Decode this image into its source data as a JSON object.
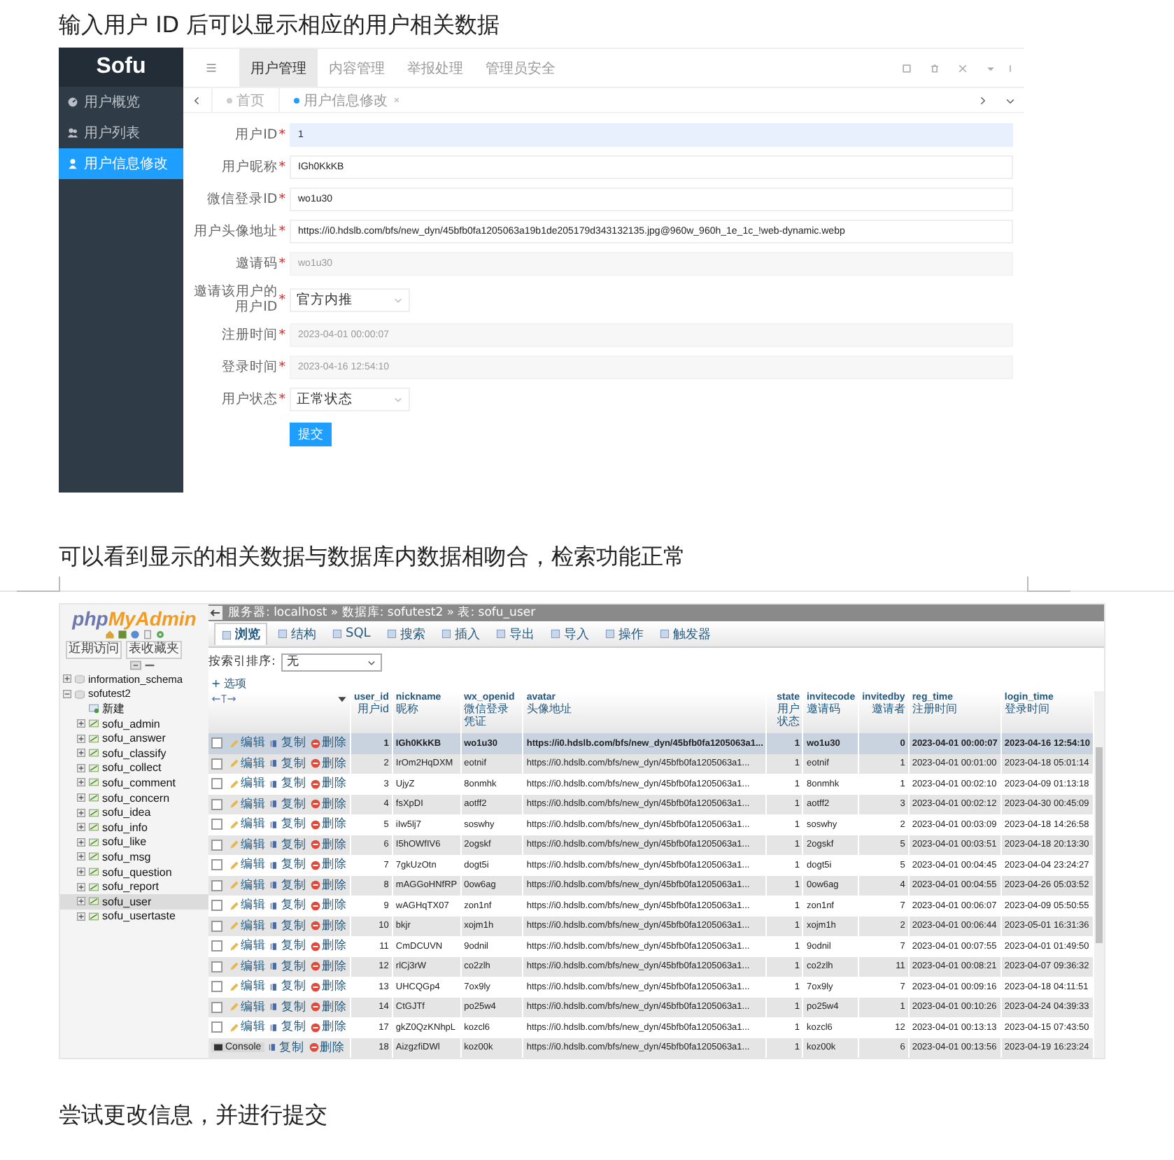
{
  "intro_text": "输入用户 ID 后可以显示相应的用户相关数据",
  "admin": {
    "logo": "Sofu",
    "sidebar": [
      {
        "label": "用户概览",
        "selected": false
      },
      {
        "label": "用户列表",
        "selected": false
      },
      {
        "label": "用户信息修改",
        "selected": true
      }
    ],
    "top_tabs": [
      {
        "label": "用户管理",
        "selected": true
      },
      {
        "label": "内容管理",
        "selected": false
      },
      {
        "label": "举报处理",
        "selected": false
      },
      {
        "label": "管理员安全",
        "selected": false
      }
    ],
    "page_tabs": [
      {
        "label": "首页",
        "selected": false,
        "closable": false
      },
      {
        "label": "用户信息修改",
        "selected": true,
        "closable": true
      }
    ],
    "fields": [
      {
        "label": "用户ID",
        "mark": "*",
        "kind": "autofill",
        "value": "1"
      },
      {
        "label": "用户昵称",
        "mark": "*",
        "kind": "input",
        "value": "IGh0KkKB"
      },
      {
        "label": "微信登录ID",
        "mark": "*",
        "kind": "input",
        "value": "wo1u30"
      },
      {
        "label": "用户头像地址",
        "mark": "*",
        "kind": "input",
        "value": "https://i0.hdslb.com/bfs/new_dyn/45bfb0fa1205063a19b1de205179d343132135.jpg@960w_960h_1e_1c_!web-dynamic.webp"
      },
      {
        "label": "邀请码",
        "mark": "*",
        "kind": "readonly",
        "value": "wo1u30"
      },
      {
        "label": "邀请该用户的用户ID",
        "mark": "*",
        "kind": "select",
        "value": "官方内推"
      },
      {
        "label": "注册时间",
        "mark": "*",
        "kind": "readonly",
        "value": "2023-04-01 00:00:07"
      },
      {
        "label": "登录时间",
        "mark": "*",
        "kind": "readonly",
        "value": "2023-04-16 12:54:10"
      },
      {
        "label": "用户状态",
        "mark": "*",
        "kind": "select",
        "value": "正常状态"
      }
    ],
    "submit": "提交"
  },
  "result_text": "可以看到显示的相关数据与数据库内数据相吻合，检索功能正常",
  "pma": {
    "logo": {
      "prefix": "php",
      "name": "MyAdmin"
    },
    "nav_buttons": [
      "近期访问",
      "表收藏夹"
    ],
    "tree": [
      {
        "label": "information_schema",
        "kind": "db",
        "expanded": false,
        "selected": false
      },
      {
        "label": "sofutest2",
        "kind": "db",
        "expanded": true,
        "selected": false,
        "children": [
          {
            "label": "新建",
            "kind": "new",
            "selected": false
          },
          {
            "label": "sofu_admin",
            "kind": "table",
            "selected": false
          },
          {
            "label": "sofu_answer",
            "kind": "table",
            "selected": false
          },
          {
            "label": "sofu_classify",
            "kind": "table",
            "selected": false
          },
          {
            "label": "sofu_collect",
            "kind": "table",
            "selected": false
          },
          {
            "label": "sofu_comment",
            "kind": "table",
            "selected": false
          },
          {
            "label": "sofu_concern",
            "kind": "table",
            "selected": false
          },
          {
            "label": "sofu_idea",
            "kind": "table",
            "selected": false
          },
          {
            "label": "sofu_info",
            "kind": "table",
            "selected": false
          },
          {
            "label": "sofu_like",
            "kind": "table",
            "selected": false
          },
          {
            "label": "sofu_msg",
            "kind": "table",
            "selected": false
          },
          {
            "label": "sofu_question",
            "kind": "table",
            "selected": false
          },
          {
            "label": "sofu_report",
            "kind": "table",
            "selected": false
          },
          {
            "label": "sofu_user",
            "kind": "table",
            "selected": true
          },
          {
            "label": "sofu_usertaste",
            "kind": "table",
            "selected": false
          }
        ]
      }
    ],
    "breadcrumb": "服务器: localhost » 数据库: sofutest2 » 表: sofu_user",
    "tabs": [
      {
        "label": "浏览",
        "selected": true
      },
      {
        "label": "结构",
        "selected": false
      },
      {
        "label": "SQL",
        "selected": false
      },
      {
        "label": "搜索",
        "selected": false
      },
      {
        "label": "插入",
        "selected": false
      },
      {
        "label": "导出",
        "selected": false
      },
      {
        "label": "导入",
        "selected": false
      },
      {
        "label": "操作",
        "selected": false
      },
      {
        "label": "触发器",
        "selected": false
      }
    ],
    "sort_label": "按索引排序:",
    "sort_value": "无",
    "options_link": "+ 选项",
    "console_label": "Console",
    "columns": [
      {
        "name": "user_id",
        "comment": "用户id",
        "numeric": true
      },
      {
        "name": "nickname",
        "comment": "昵称",
        "numeric": false
      },
      {
        "name": "wx_openid",
        "comment": "微信登录凭证",
        "numeric": false
      },
      {
        "name": "avatar",
        "comment": "头像地址",
        "numeric": false
      },
      {
        "name": "state",
        "comment": "用户状态",
        "numeric": true
      },
      {
        "name": "invitecode",
        "comment": "邀请码",
        "numeric": false
      },
      {
        "name": "invitedby",
        "comment": "邀请者",
        "numeric": true
      },
      {
        "name": "reg_time",
        "comment": "注册时间",
        "numeric": false
      },
      {
        "name": "login_time",
        "comment": "登录时间",
        "numeric": false
      }
    ],
    "rows": [
      {
        "kind": "normal",
        "selected": true,
        "actions": [
          {
            "kind": "edit",
            "label": "编辑"
          },
          {
            "kind": "copy",
            "label": "复制"
          },
          {
            "kind": "delete",
            "label": "删除"
          }
        ],
        "cells": [
          "1",
          "IGh0KkKB",
          "wo1u30",
          "https://i0.hdslb.com/bfs/new_dyn/45bfb0fa1205063a1...",
          "1",
          "wo1u30",
          "0",
          "2023-04-01 00:00:07",
          "2023-04-16 12:54:10"
        ]
      },
      {
        "kind": "normal",
        "selected": false,
        "actions": [
          {
            "kind": "edit",
            "label": "编辑"
          },
          {
            "kind": "copy",
            "label": "复制"
          },
          {
            "kind": "delete",
            "label": "删除"
          }
        ],
        "cells": [
          "2",
          "IrOm2HqDXM",
          "eotnif",
          "https://i0.hdslb.com/bfs/new_dyn/45bfb0fa1205063a1...",
          "1",
          "eotnif",
          "1",
          "2023-04-01 00:01:00",
          "2023-04-18 05:01:14"
        ]
      },
      {
        "kind": "normal",
        "selected": false,
        "actions": [
          {
            "kind": "edit",
            "label": "编辑"
          },
          {
            "kind": "copy",
            "label": "复制"
          },
          {
            "kind": "delete",
            "label": "删除"
          }
        ],
        "cells": [
          "3",
          "UjyZ",
          "8onmhk",
          "https://i0.hdslb.com/bfs/new_dyn/45bfb0fa1205063a1...",
          "1",
          "8onmhk",
          "1",
          "2023-04-01 00:02:10",
          "2023-04-09 01:13:18"
        ]
      },
      {
        "kind": "normal",
        "selected": false,
        "actions": [
          {
            "kind": "edit",
            "label": "编辑"
          },
          {
            "kind": "copy",
            "label": "复制"
          },
          {
            "kind": "delete",
            "label": "删除"
          }
        ],
        "cells": [
          "4",
          "fsXpDI",
          "aotff2",
          "https://i0.hdslb.com/bfs/new_dyn/45bfb0fa1205063a1...",
          "1",
          "aotff2",
          "3",
          "2023-04-01 00:02:12",
          "2023-04-30 00:45:09"
        ]
      },
      {
        "kind": "normal",
        "selected": false,
        "actions": [
          {
            "kind": "edit",
            "label": "编辑"
          },
          {
            "kind": "copy",
            "label": "复制"
          },
          {
            "kind": "delete",
            "label": "删除"
          }
        ],
        "cells": [
          "5",
          "iIw5lj7",
          "soswhy",
          "https://i0.hdslb.com/bfs/new_dyn/45bfb0fa1205063a1...",
          "1",
          "soswhy",
          "2",
          "2023-04-01 00:03:09",
          "2023-04-18 14:26:58"
        ]
      },
      {
        "kind": "normal",
        "selected": false,
        "actions": [
          {
            "kind": "edit",
            "label": "编辑"
          },
          {
            "kind": "copy",
            "label": "复制"
          },
          {
            "kind": "delete",
            "label": "删除"
          }
        ],
        "cells": [
          "6",
          "I5hOWfIV6",
          "2ogskf",
          "https://i0.hdslb.com/bfs/new_dyn/45bfb0fa1205063a1...",
          "1",
          "2ogskf",
          "5",
          "2023-04-01 00:03:51",
          "2023-04-18 20:13:30"
        ]
      },
      {
        "kind": "normal",
        "selected": false,
        "actions": [
          {
            "kind": "edit",
            "label": "编辑"
          },
          {
            "kind": "copy",
            "label": "复制"
          },
          {
            "kind": "delete",
            "label": "删除"
          }
        ],
        "cells": [
          "7",
          "7gkUzOtn",
          "dogt5i",
          "https://i0.hdslb.com/bfs/new_dyn/45bfb0fa1205063a1...",
          "1",
          "dogt5i",
          "5",
          "2023-04-01 00:04:45",
          "2023-04-04 23:24:27"
        ]
      },
      {
        "kind": "normal",
        "selected": false,
        "actions": [
          {
            "kind": "edit",
            "label": "编辑"
          },
          {
            "kind": "copy",
            "label": "复制"
          },
          {
            "kind": "delete",
            "label": "删除"
          }
        ],
        "cells": [
          "8",
          "mAGGoHNfRP",
          "0ow6ag",
          "https://i0.hdslb.com/bfs/new_dyn/45bfb0fa1205063a1...",
          "1",
          "0ow6ag",
          "4",
          "2023-04-01 00:04:55",
          "2023-04-26 05:03:52"
        ]
      },
      {
        "kind": "normal",
        "selected": false,
        "actions": [
          {
            "kind": "edit",
            "label": "编辑"
          },
          {
            "kind": "copy",
            "label": "复制"
          },
          {
            "kind": "delete",
            "label": "删除"
          }
        ],
        "cells": [
          "9",
          "wAGHqTX07",
          "zon1nf",
          "https://i0.hdslb.com/bfs/new_dyn/45bfb0fa1205063a1...",
          "1",
          "zon1nf",
          "7",
          "2023-04-01 00:06:07",
          "2023-04-09 05:50:55"
        ]
      },
      {
        "kind": "normal",
        "selected": false,
        "actions": [
          {
            "kind": "edit",
            "label": "编辑"
          },
          {
            "kind": "copy",
            "label": "复制"
          },
          {
            "kind": "delete",
            "label": "删除"
          }
        ],
        "cells": [
          "10",
          "bkjr",
          "xojm1h",
          "https://i0.hdslb.com/bfs/new_dyn/45bfb0fa1205063a1...",
          "1",
          "xojm1h",
          "2",
          "2023-04-01 00:06:44",
          "2023-05-01 16:31:36"
        ]
      },
      {
        "kind": "normal",
        "selected": false,
        "actions": [
          {
            "kind": "edit",
            "label": "编辑"
          },
          {
            "kind": "copy",
            "label": "复制"
          },
          {
            "kind": "delete",
            "label": "删除"
          }
        ],
        "cells": [
          "11",
          "CmDCUVN",
          "9odnil",
          "https://i0.hdslb.com/bfs/new_dyn/45bfb0fa1205063a1...",
          "1",
          "9odnil",
          "7",
          "2023-04-01 00:07:55",
          "2023-04-01 01:49:50"
        ]
      },
      {
        "kind": "normal",
        "selected": false,
        "actions": [
          {
            "kind": "edit",
            "label": "编辑"
          },
          {
            "kind": "copy",
            "label": "复制"
          },
          {
            "kind": "delete",
            "label": "删除"
          }
        ],
        "cells": [
          "12",
          "rlCj3rW",
          "co2zlh",
          "https://i0.hdslb.com/bfs/new_dyn/45bfb0fa1205063a1...",
          "1",
          "co2zlh",
          "11",
          "2023-04-01 00:08:21",
          "2023-04-07 09:36:32"
        ]
      },
      {
        "kind": "normal",
        "selected": false,
        "actions": [
          {
            "kind": "edit",
            "label": "编辑"
          },
          {
            "kind": "copy",
            "label": "复制"
          },
          {
            "kind": "delete",
            "label": "删除"
          }
        ],
        "cells": [
          "13",
          "UHCQGp4",
          "7ox9ly",
          "https://i0.hdslb.com/bfs/new_dyn/45bfb0fa1205063a1...",
          "1",
          "7ox9ly",
          "7",
          "2023-04-01 00:09:16",
          "2023-04-18 04:11:51"
        ]
      },
      {
        "kind": "normal",
        "selected": false,
        "actions": [
          {
            "kind": "edit",
            "label": "编辑"
          },
          {
            "kind": "copy",
            "label": "复制"
          },
          {
            "kind": "delete",
            "label": "删除"
          }
        ],
        "cells": [
          "14",
          "CtGJTf",
          "po25w4",
          "https://i0.hdslb.com/bfs/new_dyn/45bfb0fa1205063a1...",
          "1",
          "po25w4",
          "1",
          "2023-04-01 00:10:26",
          "2023-04-24 04:39:33"
        ]
      },
      {
        "kind": "normal",
        "selected": false,
        "actions": [
          {
            "kind": "edit",
            "label": "编辑"
          },
          {
            "kind": "copy",
            "label": "复制"
          },
          {
            "kind": "delete",
            "label": "删除"
          }
        ],
        "cells": [
          "17",
          "gkZ0QzKNhpL",
          "kozcl6",
          "https://i0.hdslb.com/bfs/new_dyn/45bfb0fa1205063a1...",
          "1",
          "kozcl6",
          "12",
          "2023-04-01 00:13:13",
          "2023-04-15 07:43:50"
        ]
      },
      {
        "kind": "console",
        "selected": false,
        "actions": [
          {
            "kind": "copy",
            "label": "复制"
          },
          {
            "kind": "delete",
            "label": "删除"
          }
        ],
        "cells": [
          "18",
          "AizgzfiDWl",
          "koz00k",
          "https://i0.hdslb.com/bfs/new_dyn/45bfb0fa1205063a1...",
          "1",
          "koz00k",
          "6",
          "2023-04-01 00:13:56",
          "2023-04-19 16:23:24"
        ]
      }
    ]
  },
  "next_text": "尝试更改信息，并进行提交"
}
